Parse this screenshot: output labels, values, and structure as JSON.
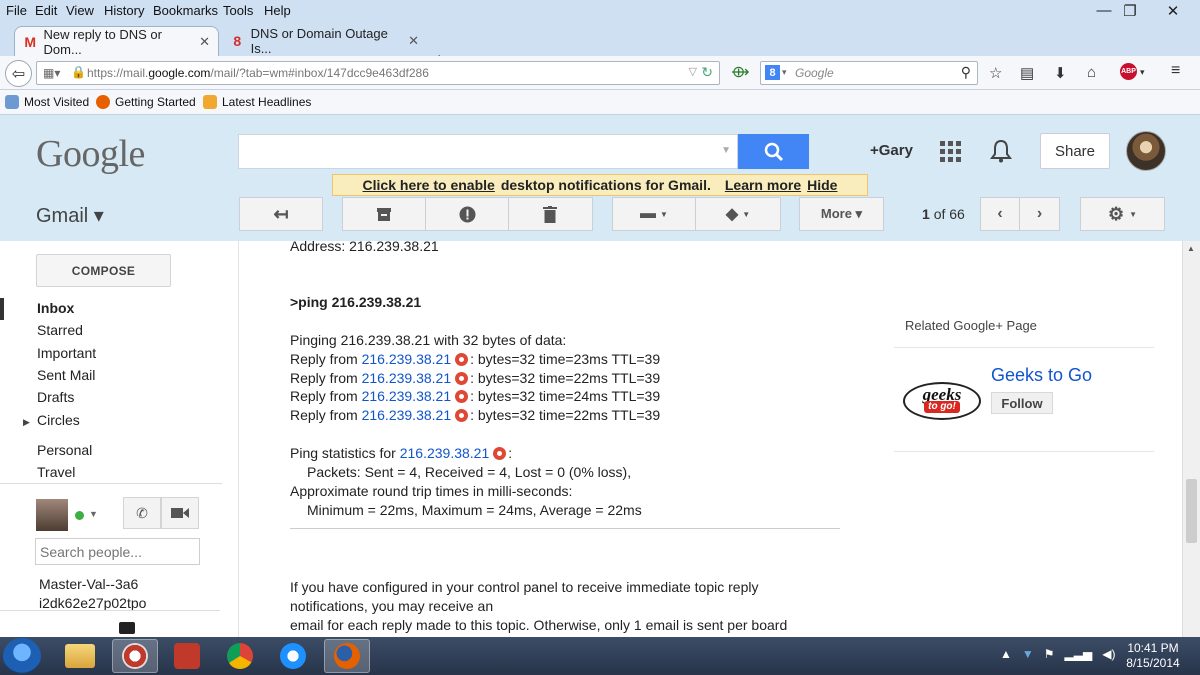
{
  "menubar": {
    "items": [
      "File",
      "Edit",
      "View",
      "History",
      "Bookmarks",
      "Tools",
      "Help"
    ]
  },
  "window_controls": {
    "minimize": "—",
    "maximize": "❐",
    "close": "✕"
  },
  "tabs": [
    {
      "title": "New reply to DNS or Dom...",
      "close": "✕",
      "active": true
    },
    {
      "title": "DNS or Domain Outage Is...",
      "close": "✕",
      "active": false
    }
  ],
  "new_tab_label": "+",
  "address": {
    "prefix": "https://mail.",
    "host": "google.com",
    "path": "/mail/?tab=wm#inbox/147dcc9e463df286"
  },
  "browser_search": {
    "engine_letter": "8",
    "placeholder": "Google"
  },
  "bookmarks": [
    "Most Visited",
    "Getting Started",
    "Latest Headlines"
  ],
  "gmail": {
    "logo": "Google",
    "user_link": "+Gary",
    "share_label": "Share",
    "notification": {
      "link": "Click here to enable",
      "text": "desktop notifications for Gmail.",
      "learn_more": "Learn more",
      "hide": "Hide"
    },
    "product_label": "Gmail ▾",
    "more_label": "More ▾",
    "pager": {
      "current": "1",
      "of_total": "of 66"
    }
  },
  "nav": {
    "compose": "COMPOSE",
    "items": [
      "Inbox",
      "Starred",
      "Important",
      "Sent Mail",
      "Drafts",
      "Circles",
      "Personal",
      "Travel"
    ],
    "people_placeholder": "Search people...",
    "contact_line1": "Master-Val--3a6",
    "contact_line2": "i2dk62e27p02tpo"
  },
  "message": {
    "address_line": "Address:  216.239.38.21",
    "ping_cmd": ">ping 216.239.38.21",
    "pinging": "Pinging 216.239.38.21 with 32 bytes of data:",
    "reply_prefix": "Reply from",
    "ip": "216.239.38.21",
    "replies": [
      ": bytes=32 time=23ms TTL=39",
      ": bytes=32 time=22ms TTL=39",
      ": bytes=32 time=24ms TTL=39",
      ": bytes=32 time=22ms TTL=39"
    ],
    "stats_prefix": "Ping statistics for",
    "stats_suffix": ":",
    "packets": "Packets: Sent = 4, Received = 4, Lost = 0 (0% loss),",
    "approx": "Approximate round trip times in milli-seconds:",
    "minmax": "Minimum = 22ms, Maximum = 24ms, Average = 22ms",
    "footer1": "If you have configured in your control panel to receive immediate topic reply",
    "footer2": "notifications, you may receive an",
    "footer3": "email for each reply made to this topic. Otherwise, only 1 email is sent per board"
  },
  "related": {
    "label": "Related Google+ Page",
    "page_name": "Geeks to Go",
    "follow": "Follow",
    "logo_top": "geeks",
    "logo_bottom": "to go!"
  },
  "taskbar": {
    "time": "10:41 PM",
    "date": "8/15/2014"
  },
  "colors": {
    "gmail_header": "#d6e9f5",
    "search_blue": "#4285f4",
    "link": "#1155cc",
    "notif_bg": "#f9edbe"
  }
}
